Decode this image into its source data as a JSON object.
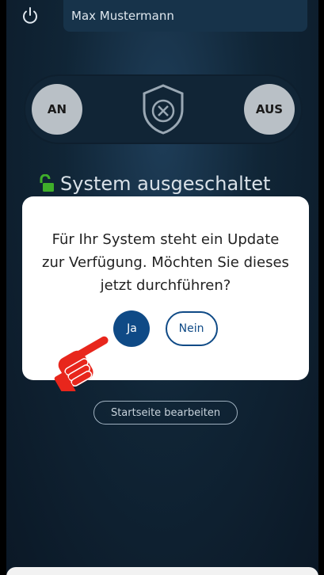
{
  "header": {
    "user_name": "Max Mustermann",
    "power_icon": "power-icon"
  },
  "toggle": {
    "on_label": "AN",
    "off_label": "AUS",
    "center_icon": "shield-x-icon"
  },
  "status": {
    "text": "System ausgeschaltet",
    "icon": "unlocked-padlock-icon",
    "icon_color": "#3fae2a"
  },
  "dialog": {
    "message": "Für Ihr System steht ein Update zur Verfügung. Möchten Sie dieses jetzt durchführen?",
    "yes_label": "Ja",
    "no_label": "Nein",
    "accent": "#0f4a86"
  },
  "edit_home_label": "Startseite bearbeiten",
  "pointer": {
    "icon": "pointing-hand-icon",
    "color": "#e8261c"
  }
}
